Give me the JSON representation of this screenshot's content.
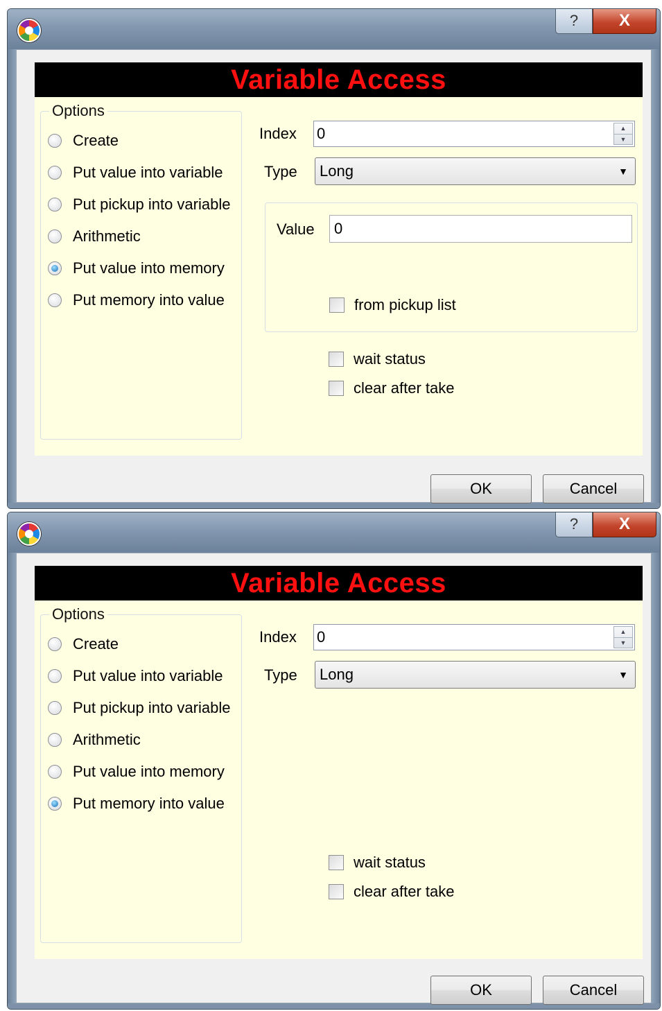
{
  "dialogs": [
    {
      "title_buttons": {
        "help": "?",
        "close": "X"
      },
      "banner": "Variable Access",
      "options_legend": "Options",
      "options": [
        {
          "label": "Create",
          "checked": false
        },
        {
          "label": "Put value into variable",
          "checked": false
        },
        {
          "label": "Put pickup into variable",
          "checked": false
        },
        {
          "label": "Arithmetic",
          "checked": false
        },
        {
          "label": "Put value into memory",
          "checked": true
        },
        {
          "label": "Put memory into value",
          "checked": false
        }
      ],
      "index_label": "Index",
      "index_value": "0",
      "type_label": "Type",
      "type_value": "Long",
      "value_label": "Value",
      "value_value": "0",
      "from_pickup_list": "from pickup list",
      "wait_status": "wait status",
      "clear_after_take": "clear after take",
      "ok": "OK",
      "cancel": "Cancel"
    },
    {
      "title_buttons": {
        "help": "?",
        "close": "X"
      },
      "banner": "Variable Access",
      "options_legend": "Options",
      "options": [
        {
          "label": "Create",
          "checked": false
        },
        {
          "label": "Put value into variable",
          "checked": false
        },
        {
          "label": "Put pickup into variable",
          "checked": false
        },
        {
          "label": "Arithmetic",
          "checked": false
        },
        {
          "label": "Put value into memory",
          "checked": false
        },
        {
          "label": "Put memory into value",
          "checked": true
        }
      ],
      "index_label": "Index",
      "index_value": "0",
      "type_label": "Type",
      "type_value": "Long",
      "wait_status": "wait status",
      "clear_after_take": "clear after take",
      "ok": "OK",
      "cancel": "Cancel"
    }
  ],
  "colors": {
    "banner_bg": "#000000",
    "banner_text": "#ff1010",
    "panel_bg": "#ffffe1",
    "close_button": "#c3462c"
  }
}
